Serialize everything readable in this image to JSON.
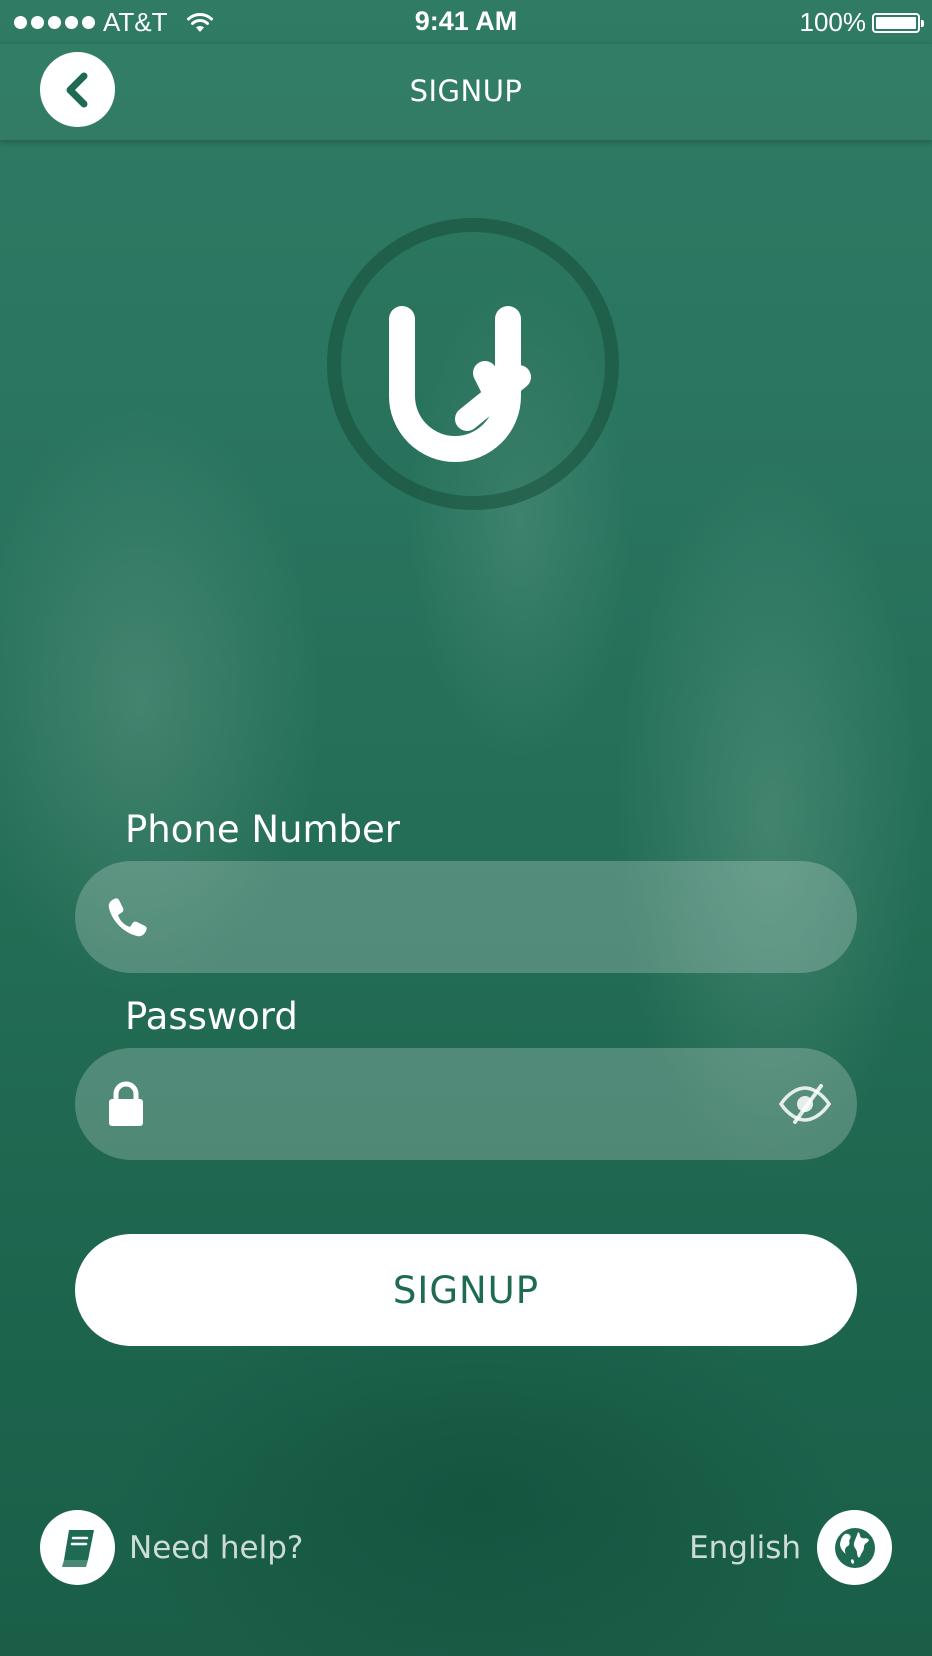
{
  "status_bar": {
    "carrier": "AT&T",
    "time": "9:41 AM",
    "battery": "100%"
  },
  "nav": {
    "title": "SIGNUP",
    "back_icon": "chevron-left-icon"
  },
  "logo": {
    "icon": "app-logo-icon"
  },
  "form": {
    "phone_label": "Phone Number",
    "phone_value": "",
    "phone_icon": "phone-icon",
    "password_label": "Password",
    "password_value": "",
    "password_icon": "lock-icon",
    "password_toggle_icon": "eye-slash-icon",
    "submit_label": "SIGNUP"
  },
  "footer": {
    "help_label": "Need help?",
    "help_icon": "book-icon",
    "language_label": "English",
    "language_icon": "globe-icon"
  },
  "colors": {
    "primary": "#1e6a52",
    "background": "#236c55",
    "text": "#ffffff"
  }
}
